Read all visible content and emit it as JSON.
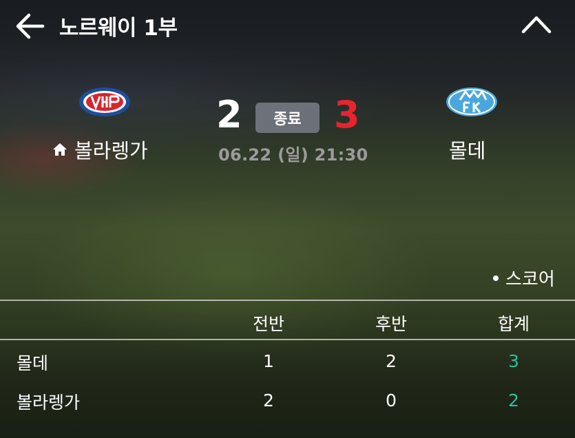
{
  "header": {
    "title": "노르웨이 1부"
  },
  "match": {
    "home": {
      "name": "볼라렝가",
      "score": "2"
    },
    "away": {
      "name": "몰데",
      "score": "3"
    },
    "status": "종료",
    "datetime": "06.22 (일) 21:30"
  },
  "legend": {
    "label": "스코어"
  },
  "table": {
    "headers": [
      "전반",
      "후반",
      "합계"
    ],
    "rows": [
      {
        "team": "몰데",
        "first_half": "1",
        "second_half": "2",
        "total": "3"
      },
      {
        "team": "볼라렝가",
        "first_half": "2",
        "second_half": "0",
        "total": "2"
      }
    ]
  },
  "colors": {
    "away_score": "#e8242f",
    "total": "#2fbf9e",
    "home_logo": "#1e4f9c",
    "away_logo": "#4aa7dd"
  },
  "icons": {
    "back": "arrow-left-icon",
    "collapse": "chevron-up-icon",
    "home": "home-icon"
  }
}
